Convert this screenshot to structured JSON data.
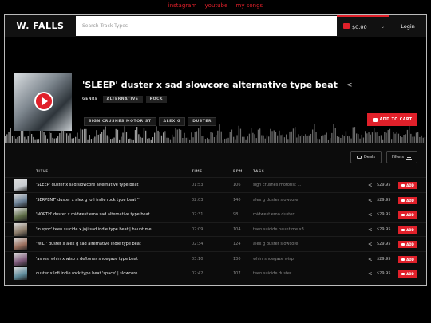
{
  "top_links": [
    "instagram",
    "youtube",
    "my songs"
  ],
  "header": {
    "logo": "W. FALLS",
    "search_placeholder": "Search Track Types",
    "cart_total": "$0.00",
    "login": "Login"
  },
  "featured": {
    "title": "'SLEEP' duster x sad slowcore alternative type beat",
    "genre_label": "GENRE",
    "genres": [
      "ALTERNATIVE",
      "ROCK"
    ],
    "tags": [
      "SIGN CRUSHES MOTORIST",
      "ALEX G",
      "DUSTER"
    ],
    "add_to_cart": "ADD TO CART"
  },
  "toolbar": {
    "deals": "Deals",
    "filters": "Filters"
  },
  "table": {
    "headers": {
      "title": "TITLE",
      "time": "TIME",
      "bpm": "BPM",
      "tags": "TAGS"
    },
    "add_label": "ADD",
    "rows": [
      {
        "title": "'SLEEP' duster x sad slowcore alternative type beat",
        "time": "01:53",
        "bpm": "106",
        "tags": "sign crushes motorist ...",
        "price": "$29.95",
        "thumb": "#c8ccd0"
      },
      {
        "title": "'SERPENT' duster x alex g lofi indie rock type beat ''",
        "time": "02:03",
        "bpm": "140",
        "tags": "alex g  duster  slowcore",
        "price": "$29.95",
        "thumb": "#6a7f94"
      },
      {
        "title": "'NORTH' duster x midwest emo sad alternative type beat",
        "time": "02:31",
        "bpm": "98",
        "tags": "midwest emo  duster ...",
        "price": "$29.95",
        "thumb": "#5c6b45"
      },
      {
        "title": "'in sync' teen suicide x joji sad indie type beat | haunt me",
        "time": "02:09",
        "bpm": "104",
        "tags": "teen suicide  haunt me x3 ...",
        "price": "$29.95",
        "thumb": "#8a7a68"
      },
      {
        "title": "'WILT' duster x alex g sad alternative indie type beat",
        "time": "02:34",
        "bpm": "124",
        "tags": "alex g  duster  slowcore",
        "price": "$29.95",
        "thumb": "#9a6e5c"
      },
      {
        "title": "'ashes' whirr x wisp x deftones shoegaze type beat",
        "time": "03:10",
        "bpm": "130",
        "tags": "whirr  shoegaze  wisp",
        "price": "$29.95",
        "thumb": "#7e5a7a"
      },
      {
        "title": "duster x lofi indie rock type beat 'space' | slowcore",
        "time": "02:42",
        "bpm": "107",
        "tags": "teen suicide  duster",
        "price": "$29.95",
        "thumb": "#5d8a9a"
      }
    ]
  },
  "colors": {
    "accent": "#e0202a"
  }
}
